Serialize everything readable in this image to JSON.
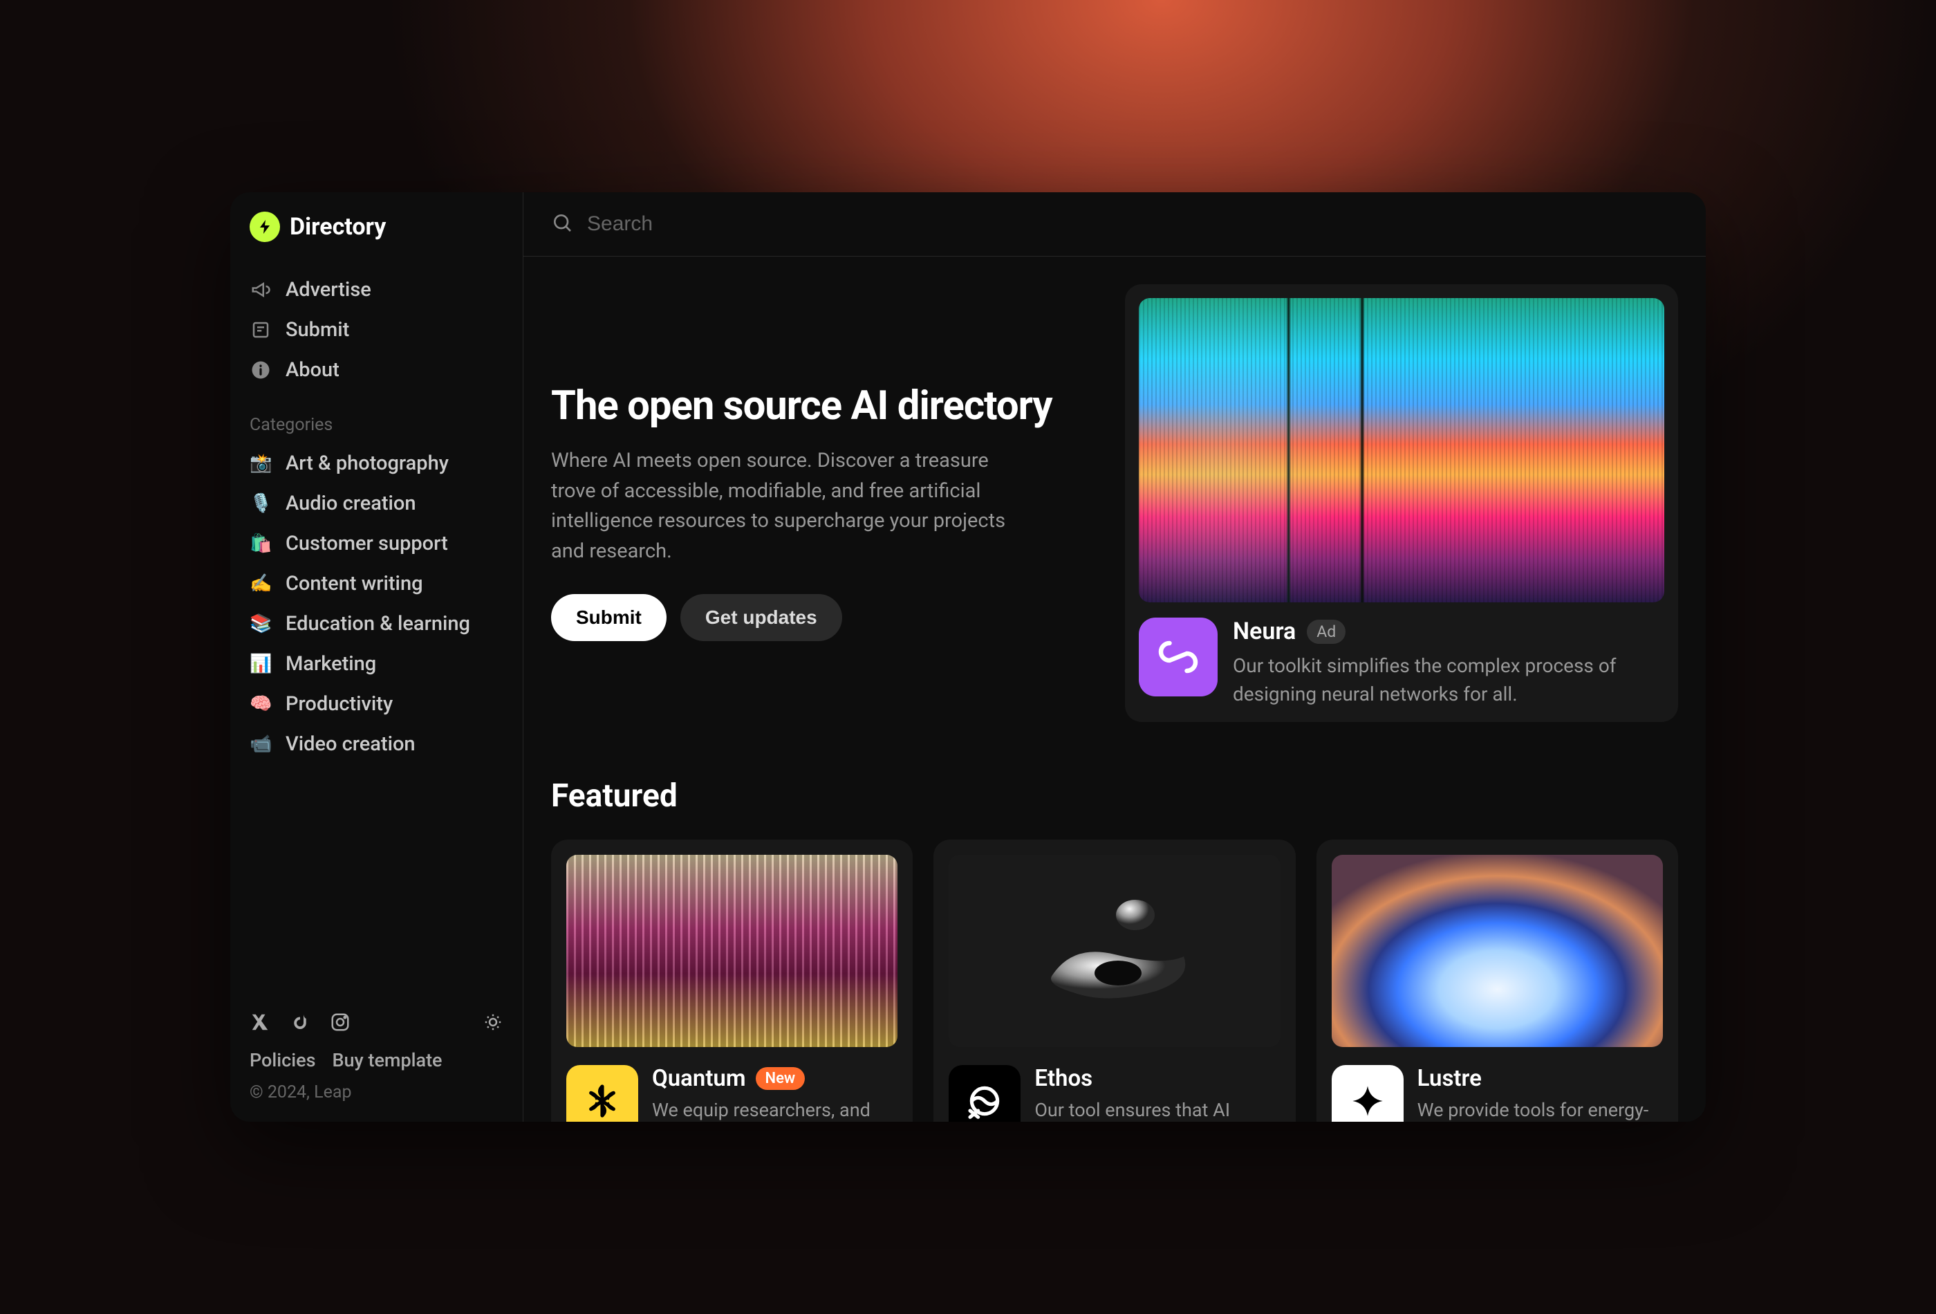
{
  "brand": {
    "name": "Directory"
  },
  "nav": {
    "items": [
      {
        "label": "Advertise",
        "name": "nav-advertise"
      },
      {
        "label": "Submit",
        "name": "nav-submit"
      },
      {
        "label": "About",
        "name": "nav-about"
      }
    ]
  },
  "categories": {
    "heading": "Categories",
    "items": [
      {
        "emoji": "📸",
        "label": "Art & photography",
        "name": "cat-art-photography"
      },
      {
        "emoji": "🎙️",
        "label": "Audio creation",
        "name": "cat-audio-creation"
      },
      {
        "emoji": "🛍️",
        "label": "Customer support",
        "name": "cat-customer-support"
      },
      {
        "emoji": "✍️",
        "label": "Content writing",
        "name": "cat-content-writing"
      },
      {
        "emoji": "📚",
        "label": "Education & learning",
        "name": "cat-education-learning"
      },
      {
        "emoji": "📊",
        "label": "Marketing",
        "name": "cat-marketing"
      },
      {
        "emoji": "🧠",
        "label": "Productivity",
        "name": "cat-productivity"
      },
      {
        "emoji": "📹",
        "label": "Video creation",
        "name": "cat-video-creation"
      }
    ]
  },
  "footer": {
    "policies": "Policies",
    "buy_template": "Buy template",
    "copyright": "© 2024, Leap"
  },
  "search": {
    "placeholder": "Search"
  },
  "hero": {
    "title": "The open source AI directory",
    "description": "Where AI meets open source. Discover a treasure trove of accessible, modifiable, and free artificial intelligence resources to supercharge your projects and research.",
    "submit_label": "Submit",
    "updates_label": "Get updates"
  },
  "promo": {
    "title": "Neura",
    "badge": "Ad",
    "description": "Our toolkit simplifies the complex process of designing neural networks for all."
  },
  "featured": {
    "heading": "Featured",
    "cards": [
      {
        "title": "Quantum",
        "badge": "New",
        "description": "We equip researchers, and"
      },
      {
        "title": "Ethos",
        "badge": null,
        "description": "Our tool ensures that AI"
      },
      {
        "title": "Lustre",
        "badge": null,
        "description": "We provide tools for energy-"
      }
    ]
  }
}
